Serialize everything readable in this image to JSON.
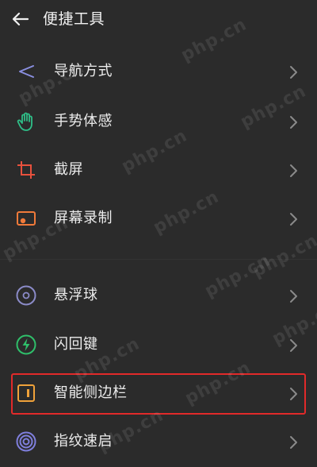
{
  "header": {
    "title": "便捷工具",
    "back_icon": "arrow-left-icon"
  },
  "items": [
    {
      "label": "导航方式",
      "icon": "navigation-icon",
      "icon_color": "#8a8fe0"
    },
    {
      "label": "手势体感",
      "icon": "hand-gesture-icon",
      "icon_color": "#2fbf88"
    },
    {
      "label": "截屏",
      "icon": "crop-icon",
      "icon_color": "#e8513d"
    },
    {
      "label": "屏幕录制",
      "icon": "screen-record-icon",
      "icon_color": "#f07a3a"
    },
    {
      "label": "悬浮球",
      "icon": "floating-ball-icon",
      "icon_color": "#8b8bc8"
    },
    {
      "label": "闪回键",
      "icon": "flashback-icon",
      "icon_color": "#2fbf6a"
    },
    {
      "label": "智能侧边栏",
      "icon": "smart-sidebar-icon",
      "icon_color": "#f0a23a"
    },
    {
      "label": "指纹速启",
      "icon": "fingerprint-icon",
      "icon_color": "#7f7fdd"
    }
  ],
  "highlighted_item": "智能侧边栏",
  "highlight_color": "#e12a2a",
  "watermark": "php.cn"
}
